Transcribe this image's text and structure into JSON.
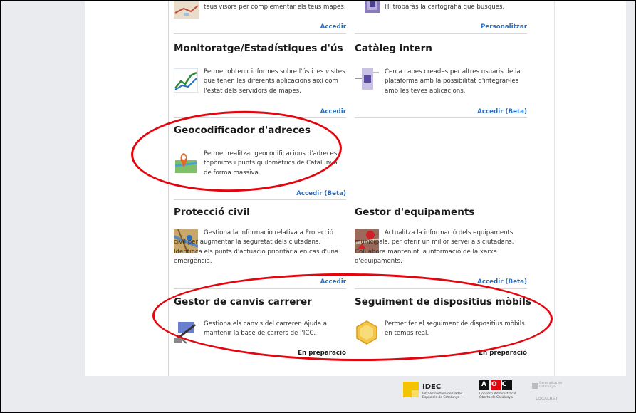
{
  "top_row": {
    "left": {
      "desc": "teus visors per complementar els teus mapes.",
      "action": "Accedir"
    },
    "right": {
      "desc": "Hi trobaràs la cartografia que busques.",
      "action": "Personalitzar"
    }
  },
  "cards": {
    "monitoratge": {
      "title": "Monitoratge/Estadístiques d'ús",
      "desc": "Permet obtenir informes sobre l'ús i les visites que tenen les diferents aplicacions així com l'estat dels servidors de mapes.",
      "action": "Accedir"
    },
    "cataleg": {
      "title": "Catàleg intern",
      "desc": "Cerca capes creades per altres usuaris de la plataforma amb la possibilitat d'integrar-les amb les teves aplicacions.",
      "action": "Accedir (Beta)"
    },
    "geocodificador": {
      "title": "Geocodificador d'adreces",
      "desc": "Permet realitzar geocodificacions d'adreces, topònims i punts quilomètrics de Catalunya de forma massiva.",
      "action": "Accedir (Beta)"
    },
    "proteccio": {
      "title": "Protecció civil",
      "desc": "Gestiona la informació relativa a Protecció civil per augmentar la seguretat dels ciutadans. Identifica els punts d'actuació prioritària en cas d'una emergència.",
      "action": "Accedir"
    },
    "equipaments": {
      "title": "Gestor d'equipaments",
      "desc": "Actualitza la informació dels equipaments municipals, per oferir un millor servei als ciutadans. Col·labora mantenint la informació de la xarxa d'equipaments.",
      "action": "Accedir (Beta)"
    },
    "carrerer": {
      "title": "Gestor de canvis carrerer",
      "desc": "Gestiona els canvis del carrerer. Ajuda a mantenir la base de carrers de l'ICC.",
      "action": "En preparació"
    },
    "mobils": {
      "title": "Seguiment de dispositius mòbils",
      "desc": "Permet fer el seguiment de dispositius mòbils en temps real.",
      "action": "En preparació"
    }
  },
  "footer": {
    "idec_name": "IDEC",
    "idec_sub": "Infraestructura de Dades Espacials de Catalunya",
    "aoc_letters": "AOC",
    "aoc_sub": "Consorci Administració Oberta de Catalunya",
    "gencat": "Generalitat de Catalunya",
    "localret": "LOCALRET"
  },
  "colors": {
    "link": "#2a6fbf",
    "highlight": "#e3060f",
    "background": "#e9ebee"
  }
}
